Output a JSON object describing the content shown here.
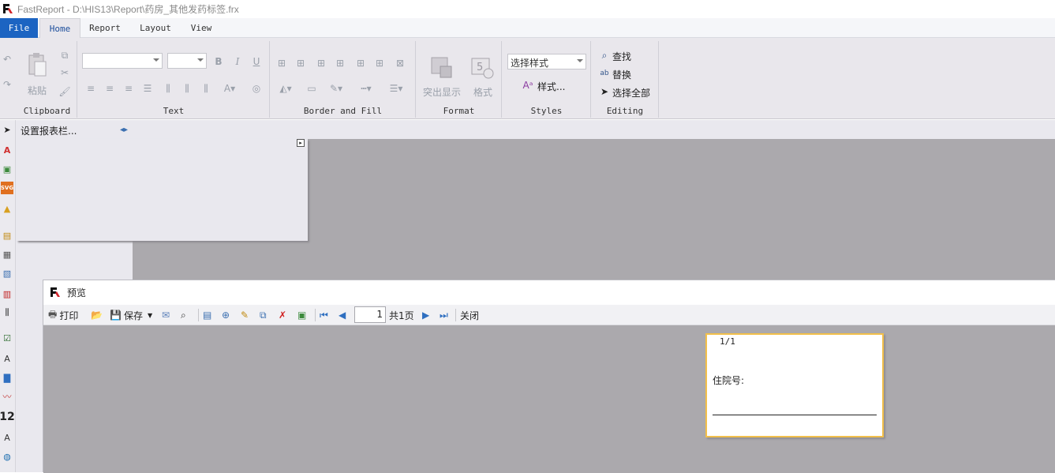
{
  "window": {
    "title": "FastReport - D:\\HIS13\\Report\\药房_其他发药标签.frx"
  },
  "menu": {
    "tabs": [
      "File",
      "Home",
      "Report",
      "Layout",
      "View"
    ],
    "active": "Home"
  },
  "ribbon": {
    "clipboard": {
      "label": "Clipboard",
      "paste_label": "粘贴"
    },
    "text": {
      "label": "Text",
      "bold": "B",
      "italic": "I",
      "underline": "U"
    },
    "border_fill": {
      "label": "Border and Fill"
    },
    "format": {
      "label": "Format",
      "highlight_label": "突出显示",
      "format_label": "格式"
    },
    "styles": {
      "label": "Styles",
      "style_combo_value": "选择样式",
      "styles_button": "样式..."
    },
    "editing": {
      "label": "Editing",
      "find": "查找",
      "replace": "替换",
      "select_all": "选择全部"
    }
  },
  "bands": {
    "configure_label": "设置报表栏..."
  },
  "preview": {
    "title": "预览",
    "toolbar": {
      "print": "打印",
      "save": "保存",
      "page_value": "1",
      "page_total": "共1页",
      "close": "关闭"
    },
    "page": {
      "page_number": "1/1",
      "field_label": "住院号:"
    }
  },
  "colors": {
    "accent": "#1c64c2",
    "canvas": "#aba9ad",
    "label_border": "#f2bf4a"
  }
}
